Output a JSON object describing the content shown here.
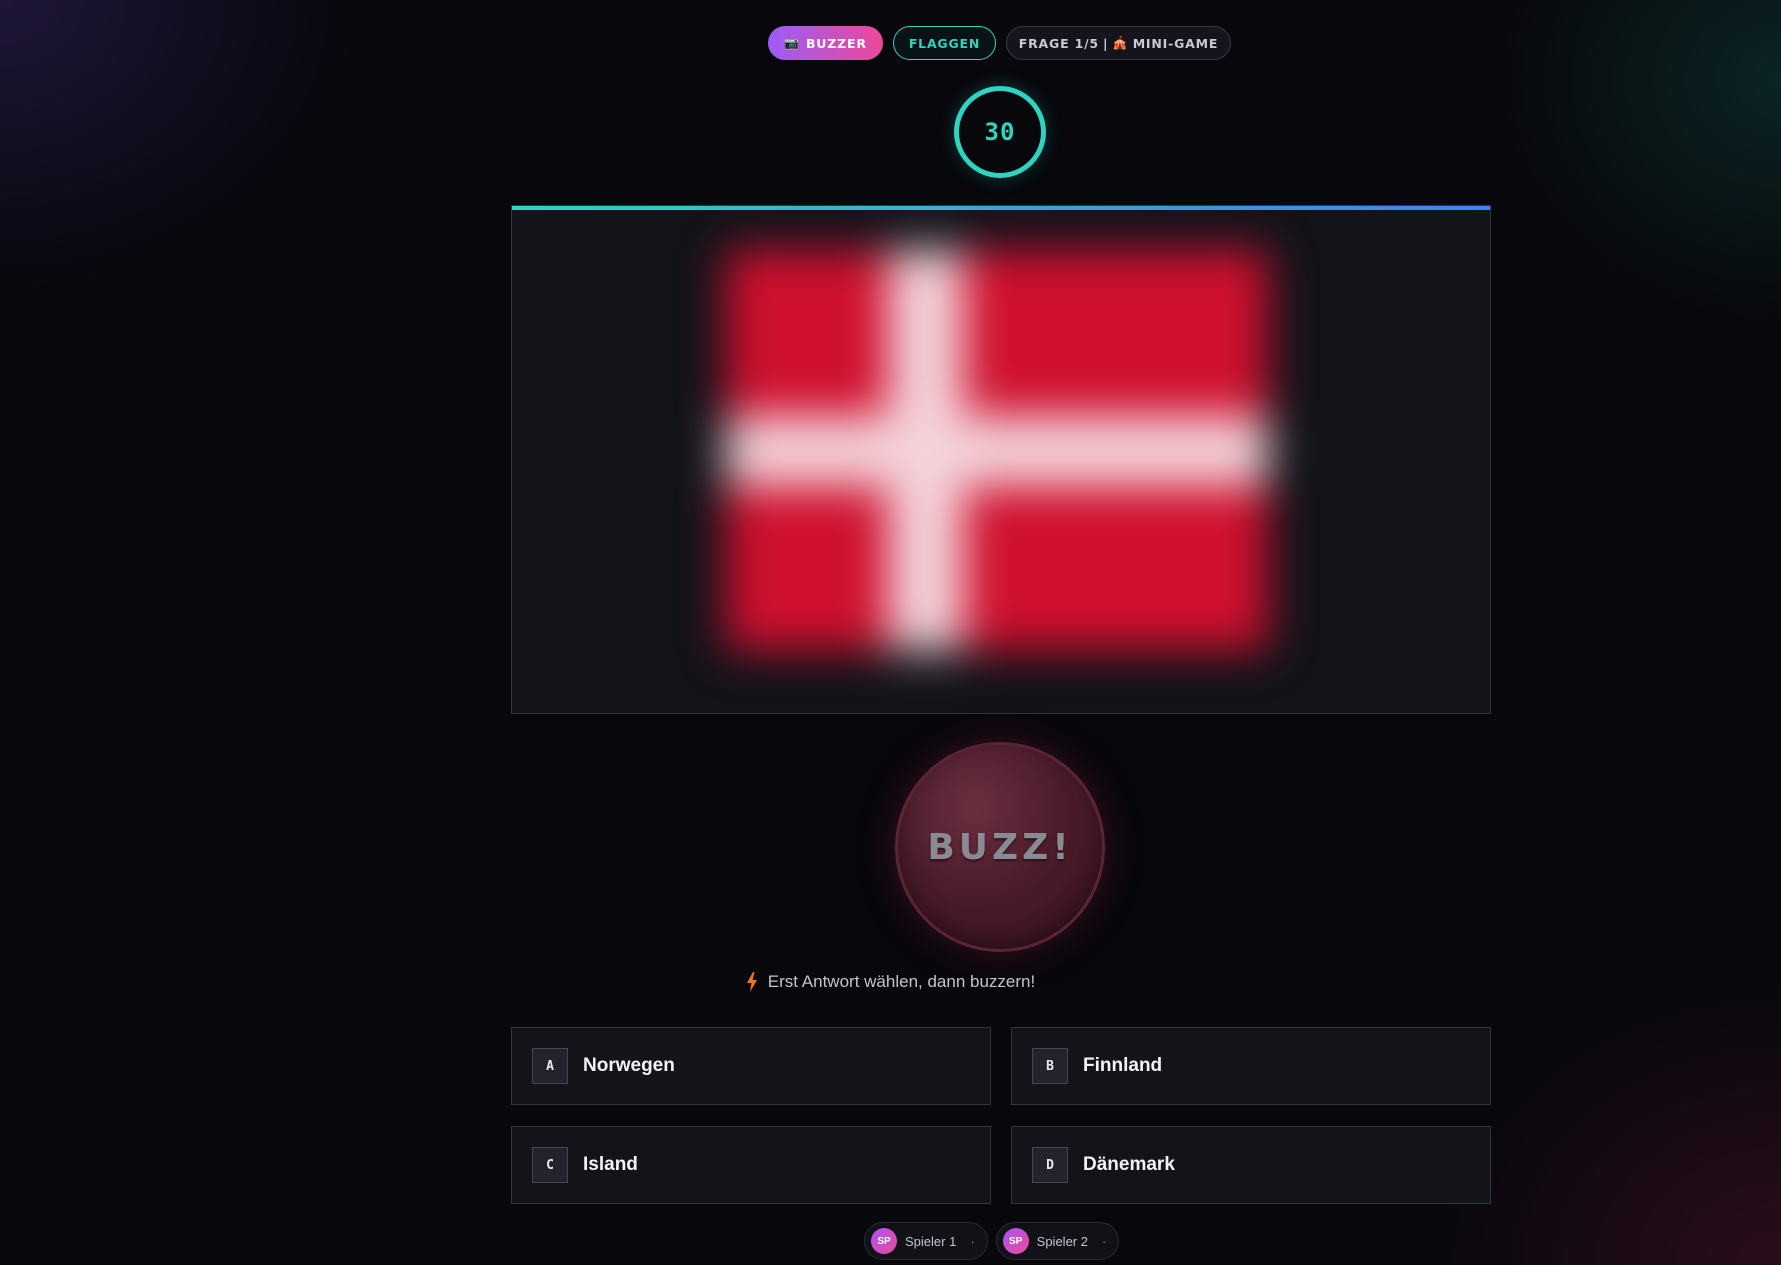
{
  "header": {
    "mode_icon": "camera-icon",
    "mode_icon_glyph": "📷",
    "mode_label": "BUZZER",
    "category_label": "FLAGGEN",
    "question_counter": "FRAGE 1/5",
    "separator": "|",
    "minigame_icon": "circus-tent-icon",
    "minigame_icon_glyph": "🎪",
    "minigame_label": "MINI-GAME"
  },
  "timer": {
    "value": "30"
  },
  "flag": {
    "icon": "denmark-flag-blurred",
    "blurred": true,
    "colors": {
      "field": "#cf102f",
      "cross": "#f4d3da"
    }
  },
  "buzz": {
    "label": "BUZZ!"
  },
  "hint": {
    "icon": "lightning-icon",
    "text": "Erst Antwort wählen, dann buzzern!"
  },
  "answers": [
    {
      "key": "A",
      "text": "Norwegen"
    },
    {
      "key": "B",
      "text": "Finnland"
    },
    {
      "key": "C",
      "text": "Island"
    },
    {
      "key": "D",
      "text": "Dänemark"
    }
  ],
  "players": [
    {
      "initials": "SP",
      "name": "Spieler 1",
      "score": "·"
    },
    {
      "initials": "SP",
      "name": "Spieler 2",
      "score": "·"
    }
  ],
  "colors": {
    "accent_teal": "#2dd4bf",
    "accent_purple": "#9b5cf6",
    "accent_pink": "#ec4899",
    "background": "#07070c",
    "card": "#13131a"
  }
}
